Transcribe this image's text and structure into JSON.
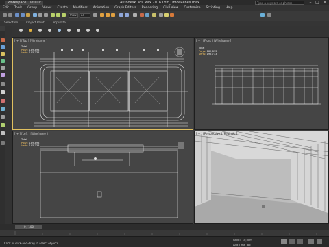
{
  "titlebar": {
    "workspace": "Workspace: Default",
    "title": "Autodesk 3ds Max 2016     Loft_OfficeRenes.max",
    "search_placeholder": "Type a keyword or phrase"
  },
  "menu": [
    "Edit",
    "Tools",
    "Group",
    "Views",
    "Create",
    "Modifiers",
    "Animation",
    "Graph Editors",
    "Rendering",
    "Civil View",
    "Customize",
    "Scripting",
    "Help"
  ],
  "toolbar": {
    "view_select": "View",
    "filter_select": "All"
  },
  "ribbon": [
    "Selection",
    "Object Paint",
    "Populate"
  ],
  "viewports": {
    "top": {
      "label": "[ + ] [Top ] [Wireframe ]",
      "stat_title": "Total",
      "polys_label": "Polys:",
      "polys_value": "189,893",
      "verts_label": "Verts:",
      "verts_value": "195,733"
    },
    "front": {
      "label": "[ + ] [Front ] [Wireframe ]",
      "stat_title": "Total",
      "polys_label": "Polys:",
      "polys_value": "189,893",
      "verts_label": "Verts:",
      "verts_value": "195,733"
    },
    "left": {
      "label": "[ + ] [Left ] [Wireframe ]",
      "stat_title": "Total",
      "polys_label": "Polys:",
      "polys_value": "189,893",
      "verts_label": "Verts:",
      "verts_value": "195,733"
    },
    "perspective": {
      "label": "[ + ] [Perspective ] [Realistic ]"
    }
  },
  "timeline": {
    "frame": "0 / 100"
  },
  "status": {
    "message": "Click or click-and-drag to select objects",
    "grid": "Grid = 10,0cm",
    "time_tag": "Add Time Tag"
  },
  "colors": {
    "accent": "#4a78c2",
    "active_border": "#e0c060"
  }
}
